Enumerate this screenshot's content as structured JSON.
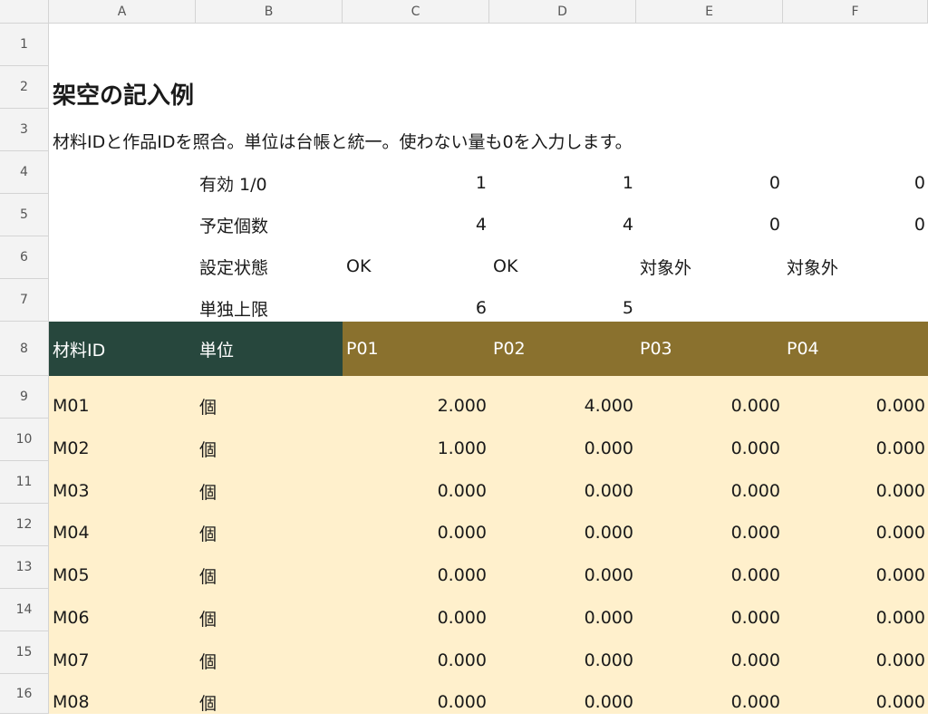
{
  "columns": [
    "A",
    "B",
    "C",
    "D",
    "E",
    "F"
  ],
  "row_numbers": [
    "1",
    "2",
    "3",
    "4",
    "5",
    "6",
    "7",
    "8",
    "9",
    "10",
    "11",
    "12",
    "13",
    "14",
    "15",
    "16"
  ],
  "title": "架空の記入例",
  "note": "材料IDと作品IDを照合。単位は台帳と統一。使わない量も0を入力します。",
  "settings": [
    {
      "label": "有効 1/0",
      "c": "1",
      "d": "1",
      "e": "0",
      "f": "0"
    },
    {
      "label": "予定個数",
      "c": "4",
      "d": "4",
      "e": "0",
      "f": "0"
    },
    {
      "label": "設定状態",
      "c": "OK",
      "d": "OK",
      "e": "対象外",
      "f": "対象外"
    },
    {
      "label": "単独上限",
      "c": "6",
      "d": "5",
      "e": "",
      "f": ""
    }
  ],
  "header": {
    "material_id": "材料ID",
    "unit": "単位",
    "p01": "P01",
    "p02": "P02",
    "p03": "P03",
    "p04": "P04"
  },
  "rows": [
    {
      "id": "M01",
      "unit": "個",
      "c": "2.000",
      "d": "4.000",
      "e": "0.000",
      "f": "0.000"
    },
    {
      "id": "M02",
      "unit": "個",
      "c": "1.000",
      "d": "0.000",
      "e": "0.000",
      "f": "0.000"
    },
    {
      "id": "M03",
      "unit": "個",
      "c": "0.000",
      "d": "0.000",
      "e": "0.000",
      "f": "0.000"
    },
    {
      "id": "M04",
      "unit": "個",
      "c": "0.000",
      "d": "0.000",
      "e": "0.000",
      "f": "0.000"
    },
    {
      "id": "M05",
      "unit": "個",
      "c": "0.000",
      "d": "0.000",
      "e": "0.000",
      "f": "0.000"
    },
    {
      "id": "M06",
      "unit": "個",
      "c": "0.000",
      "d": "0.000",
      "e": "0.000",
      "f": "0.000"
    },
    {
      "id": "M07",
      "unit": "個",
      "c": "0.000",
      "d": "0.000",
      "e": "0.000",
      "f": "0.000"
    },
    {
      "id": "M08",
      "unit": "個",
      "c": "0.000",
      "d": "0.000",
      "e": "0.000",
      "f": "0.000"
    }
  ],
  "colors": {
    "header_dark": "#27473d",
    "header_gold": "#8a712e",
    "data_fill": "#fff0cc"
  }
}
